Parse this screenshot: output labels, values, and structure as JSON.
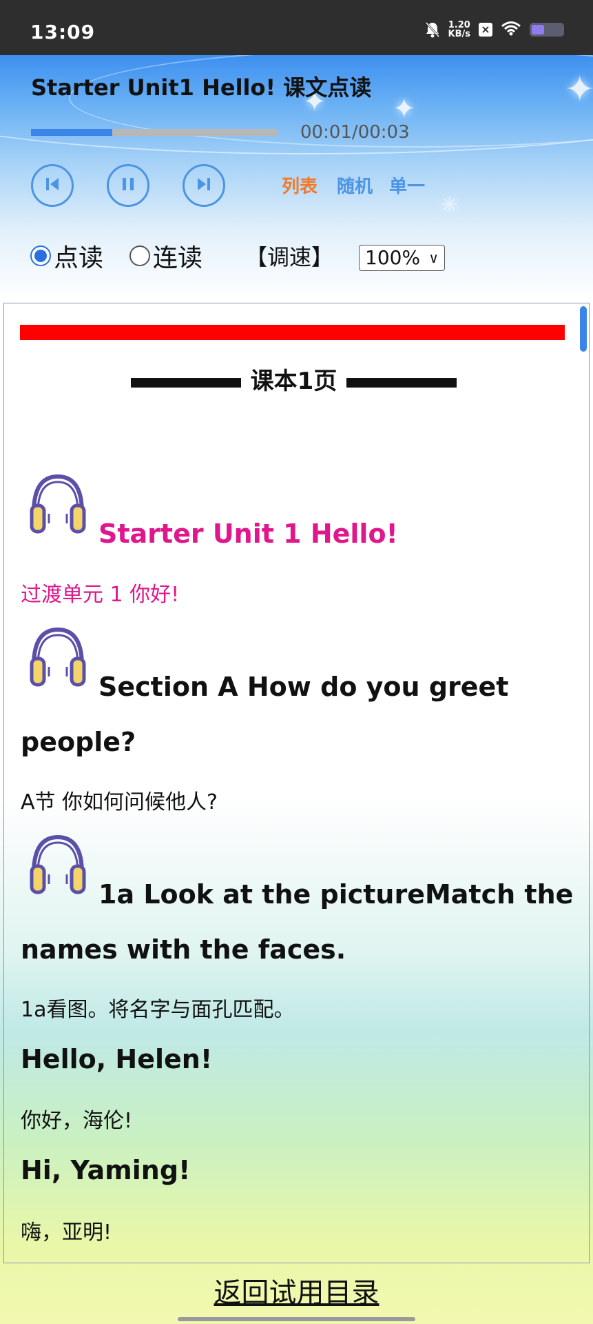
{
  "status_bar": {
    "time": "13:09",
    "net_speed_value": "1.20",
    "net_speed_unit": "KB/s",
    "battery_level": 0.4
  },
  "player": {
    "title": "Starter Unit1 Hello! 课文点读",
    "progress": 0.33,
    "time_display": "00:01/00:03",
    "modes": {
      "list": "列表",
      "random": "随机",
      "single": "单一"
    },
    "mode_colors": {
      "list": "#f07a2a",
      "random": "#4b94e6",
      "single": "#4b94e6"
    },
    "read_options": {
      "point": "点读",
      "continuous": "连读",
      "selected": "point"
    },
    "speed_label": "【调速】",
    "speed_value": "100%"
  },
  "content": {
    "page_heading": "课本1页",
    "items": [
      {
        "en": "Starter Unit 1 Hello!",
        "cn": "过渡单元 1 你好!"
      },
      {
        "en_line1": "Section A How do you greet",
        "en_line2": "people?",
        "cn": "A节 你如何问候他人?"
      },
      {
        "en_line1": "1a Look at the pictureMatch the",
        "en_line2": "names with the faces.",
        "cn": "1a看图。将名字与面孔匹配。"
      },
      {
        "en": "Hello, Helen!",
        "cn": "你好，海伦!"
      },
      {
        "en": "Hi, Yaming!",
        "cn": "嗨，亚明!"
      }
    ],
    "accent_color": "#e0168c"
  },
  "footer": {
    "back_link": "返回试用目录"
  }
}
